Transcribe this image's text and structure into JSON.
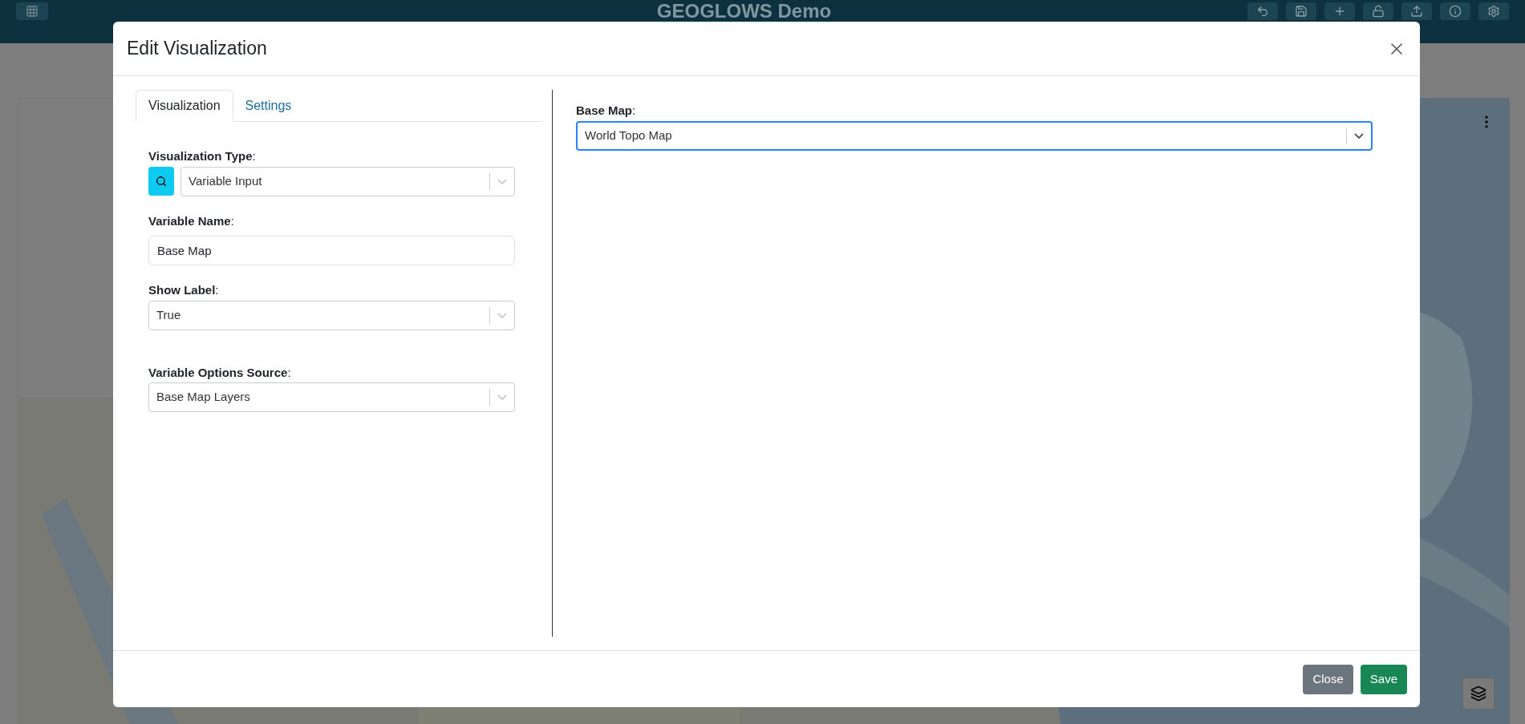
{
  "header": {
    "title": "GEOGLOWS Demo"
  },
  "dialog": {
    "title": "Edit Visualization",
    "tabs": [
      {
        "label": "Visualization",
        "selected": true
      },
      {
        "label": "Settings",
        "selected": false
      }
    ],
    "fields": [
      {
        "kind": "search-select",
        "label": "**Visualization Type**:",
        "value": "Variable Input"
      },
      {
        "kind": "text",
        "label": "**Variable Name**:",
        "value": "Base Map"
      },
      {
        "kind": "select",
        "label": "**Show Label**:",
        "value": "True"
      },
      {
        "kind": "select",
        "label": "**Variable Options Source**:",
        "value": "Base Map Layers"
      }
    ],
    "preview": {
      "label": "**Base Map**:",
      "value": "World Topo Map",
      "focused": true
    },
    "buttons": [
      {
        "label": "Close",
        "kind": "secondary"
      },
      {
        "label": "Save",
        "kind": "primary"
      }
    ]
  }
}
